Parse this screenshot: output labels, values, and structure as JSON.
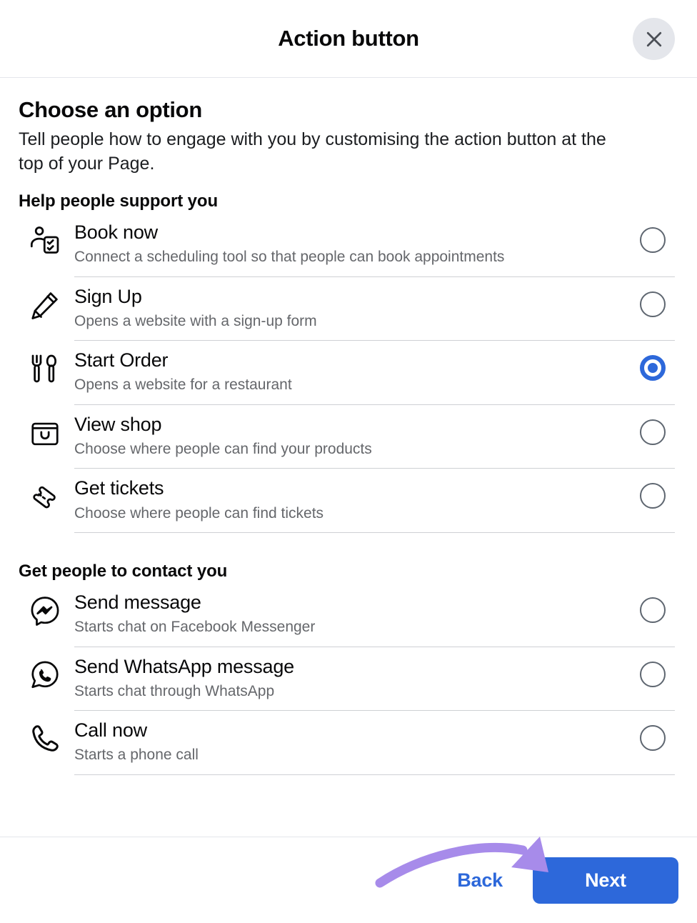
{
  "header": {
    "title": "Action button",
    "close_icon": "close-icon"
  },
  "main": {
    "section_title": "Choose an option",
    "section_desc": "Tell people how to engage with you by customising the action button at the top of your Page.",
    "groups": [
      {
        "title": "Help people support you",
        "options": [
          {
            "icon": "person-schedule-icon",
            "title": "Book now",
            "desc": "Connect a scheduling tool so that people can book appointments",
            "selected": false
          },
          {
            "icon": "pencil-icon",
            "title": "Sign Up",
            "desc": "Opens a website with a sign-up form",
            "selected": false
          },
          {
            "icon": "fork-knife-icon",
            "title": "Start Order",
            "desc": "Opens a website for a restaurant",
            "selected": true
          },
          {
            "icon": "shopping-bag-icon",
            "title": "View shop",
            "desc": "Choose where people can find your products",
            "selected": false
          },
          {
            "icon": "ticket-icon",
            "title": "Get tickets",
            "desc": "Choose where people can find tickets",
            "selected": false
          }
        ]
      },
      {
        "title": "Get people to contact you",
        "options": [
          {
            "icon": "messenger-icon",
            "title": "Send message",
            "desc": "Starts chat on Facebook Messenger",
            "selected": false
          },
          {
            "icon": "whatsapp-icon",
            "title": "Send WhatsApp message",
            "desc": "Starts chat through WhatsApp",
            "selected": false
          },
          {
            "icon": "phone-icon",
            "title": "Call now",
            "desc": "Starts a phone call",
            "selected": false
          }
        ]
      }
    ]
  },
  "footer": {
    "back_label": "Back",
    "next_label": "Next"
  },
  "annotation": {
    "type": "curved-arrow",
    "points_to": "next-button",
    "color": "#a78bea"
  },
  "colors": {
    "accent_blue": "#2d68da",
    "text_primary": "#080809",
    "text_secondary": "#65676b",
    "divider": "#ced0d4",
    "close_bg": "#e4e6eb",
    "annotation_purple": "#a78bea"
  }
}
